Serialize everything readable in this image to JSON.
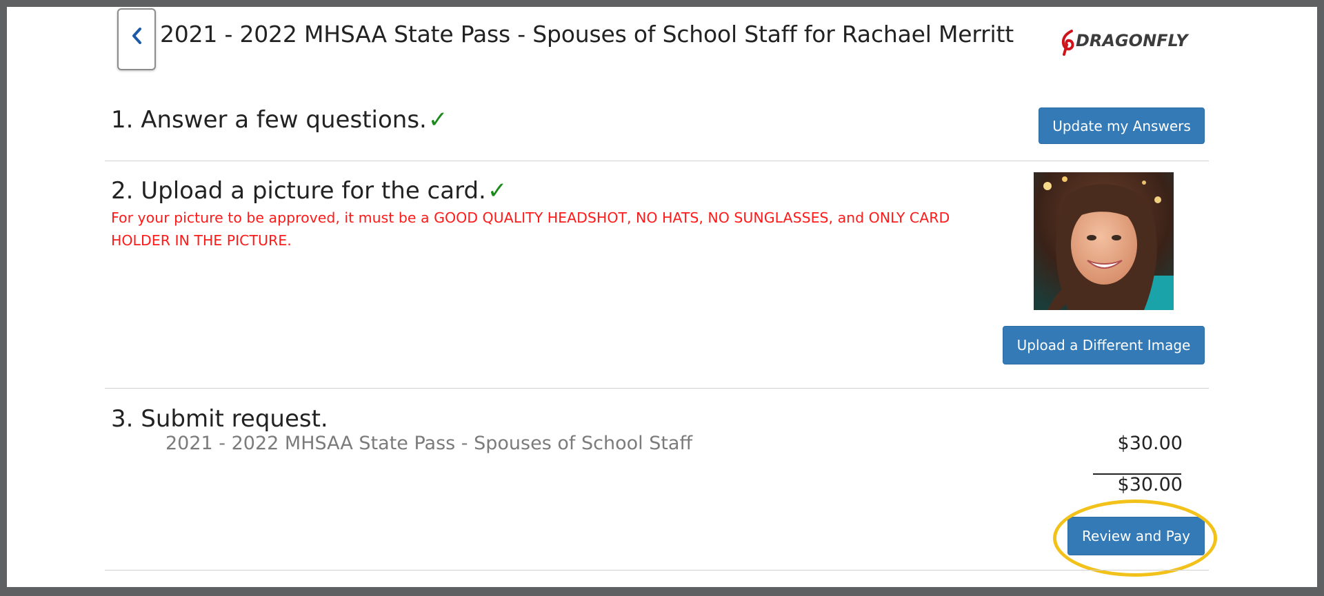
{
  "header": {
    "back_label": "back",
    "title": "2021 - 2022 MHSAA State Pass - Spouses of School Staff for Rachael Merritt",
    "logo_text": "DRAGONFLY",
    "logo_accent_color": "#d0121b"
  },
  "step1": {
    "heading": "1. Answer a few questions.",
    "check": "✓",
    "button_label": "Update my Answers"
  },
  "step2": {
    "heading": "2. Upload a picture for the card.",
    "check": "✓",
    "warning": "For your picture to be approved, it must be a GOOD QUALITY HEADSHOT, NO HATS, NO SUNGLASSES, and ONLY CARD HOLDER IN THE PICTURE.",
    "button_label": "Upload a Different Image"
  },
  "step3": {
    "heading": "3. Submit request.",
    "line_item": "2021 - 2022 MHSAA State Pass - Spouses of School Staff",
    "line_price": "$30.00",
    "total": "$30.00",
    "button_label": "Review and Pay"
  },
  "colors": {
    "primary_button": "#337ab7",
    "check_green": "#1a8a1a",
    "warning_red": "#ff1a1a",
    "highlight": "#f3c21a"
  }
}
